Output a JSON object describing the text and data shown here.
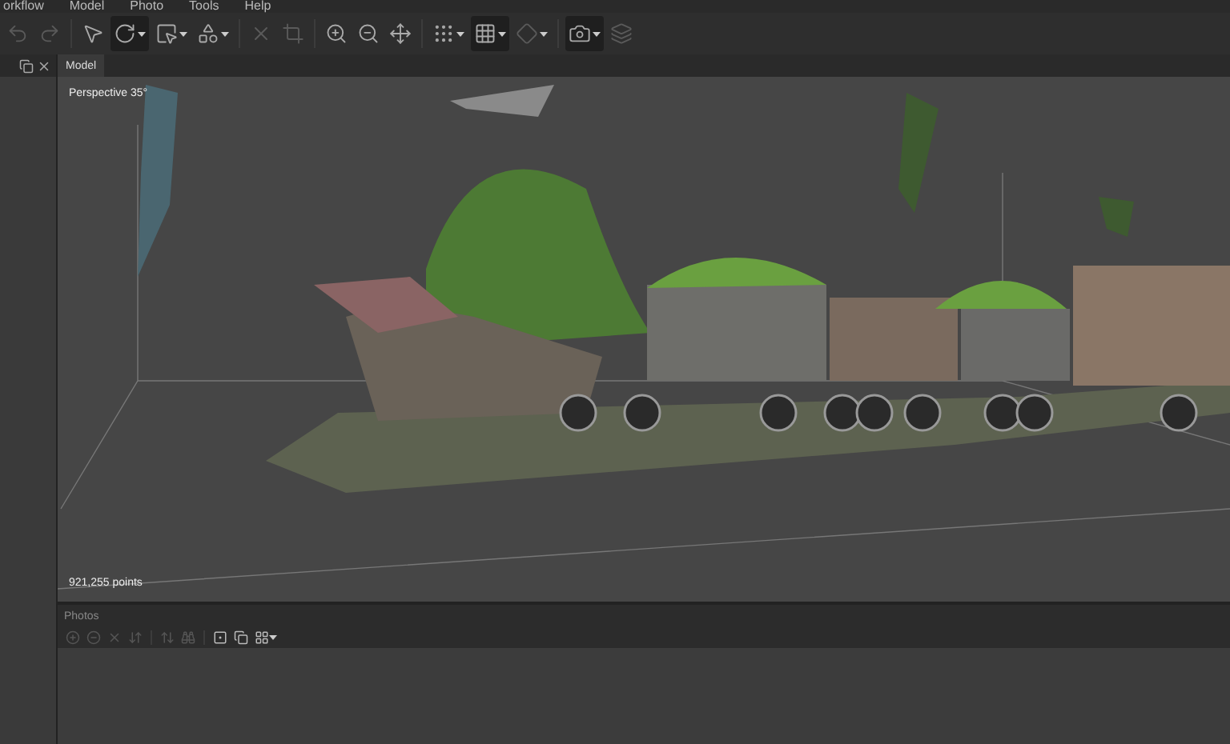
{
  "menu": [
    "orkflow",
    "Model",
    "Photo",
    "Tools",
    "Help"
  ],
  "toolbar": [
    {
      "disabled": true,
      "active": false,
      "dropdown": false
    },
    {
      "disabled": true,
      "active": false,
      "dropdown": false
    },
    {
      "disabled": false,
      "active": false,
      "dropdown": false
    },
    {
      "disabled": false,
      "active": true,
      "dropdown": true
    },
    {
      "disabled": false,
      "active": false,
      "dropdown": true
    },
    {
      "disabled": false,
      "active": false,
      "dropdown": true
    },
    {
      "disabled": true,
      "active": false,
      "dropdown": false
    },
    {
      "disabled": true,
      "active": false,
      "dropdown": false
    },
    {
      "disabled": false,
      "active": false,
      "dropdown": false
    },
    {
      "disabled": false,
      "active": false,
      "dropdown": false
    },
    {
      "disabled": false,
      "active": false,
      "dropdown": false
    },
    {
      "disabled": false,
      "active": false,
      "dropdown": true
    },
    {
      "disabled": false,
      "active": true,
      "dropdown": true
    },
    {
      "disabled": true,
      "active": false,
      "dropdown": true
    },
    {
      "disabled": false,
      "active": true,
      "dropdown": true
    },
    {
      "disabled": true,
      "active": false,
      "dropdown": false
    }
  ],
  "model_tab": {
    "label": "Model",
    "selected": true
  },
  "viewport": {
    "projection": "Perspective 35°",
    "point_count": "921,255 points"
  },
  "photos_panel": {
    "title": "Photos",
    "toolbar": [
      {
        "disabled": true,
        "dropdown": false
      },
      {
        "disabled": true,
        "dropdown": false
      },
      {
        "disabled": true,
        "dropdown": false
      },
      {
        "disabled": true,
        "dropdown": false
      },
      {
        "disabled": true,
        "dropdown": false
      },
      {
        "disabled": true,
        "dropdown": false
      },
      {
        "disabled": false,
        "dropdown": false
      },
      {
        "disabled": false,
        "dropdown": false
      },
      {
        "disabled": false,
        "dropdown": true
      }
    ]
  }
}
